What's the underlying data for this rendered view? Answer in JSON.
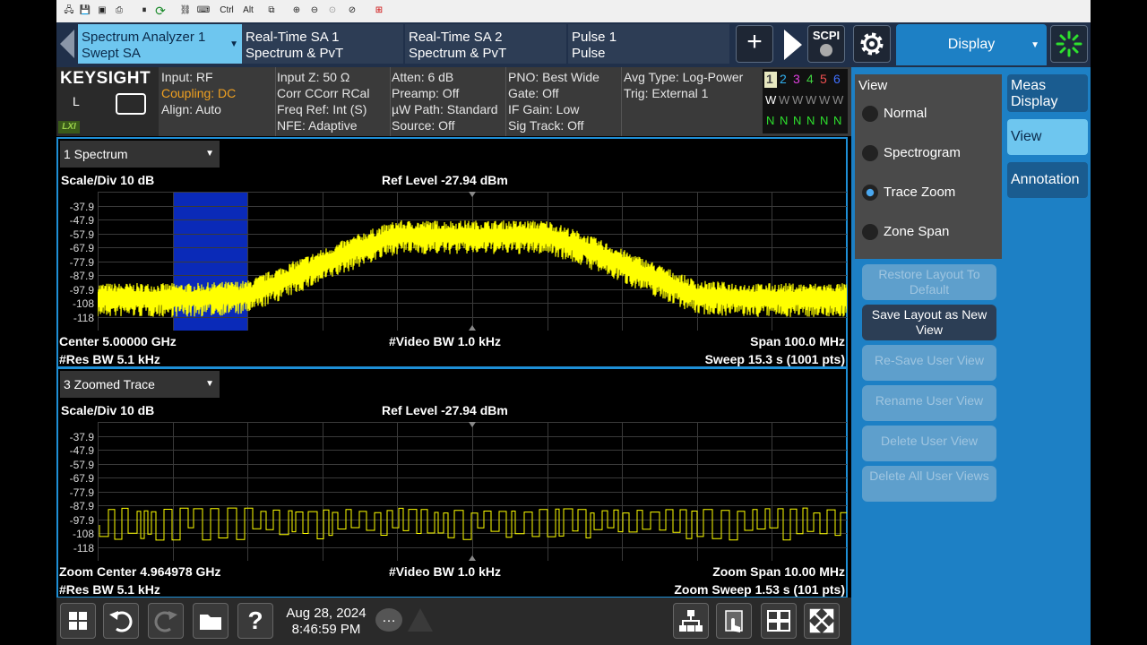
{
  "toolbar": {
    "ctrl_label": "Ctrl",
    "alt_label": "Alt"
  },
  "tabs": [
    {
      "line1": "Spectrum Analyzer 1",
      "line2": "Swept SA"
    },
    {
      "line1": "Real-Time SA 1",
      "line2": "Spectrum & PvT"
    },
    {
      "line1": "Real-Time SA 2",
      "line2": "Spectrum & PvT"
    },
    {
      "line1": "Pulse 1",
      "line2": "Pulse"
    }
  ],
  "header": {
    "scpi_label": "SCPI",
    "menu_title": "Display"
  },
  "brand": {
    "logo": "KEYSIGHT",
    "mode": "L",
    "lxi": "LXI"
  },
  "info": {
    "col1": [
      "Input: RF",
      "Coupling: DC",
      "Align: Auto"
    ],
    "col2": [
      "Input Z: 50 Ω",
      "Corr CCorr RCal",
      "Freq Ref: Int (S)",
      "NFE: Adaptive"
    ],
    "col3": [
      "Atten: 6 dB",
      "Preamp: Off",
      "µW Path: Standard",
      "Source: Off"
    ],
    "col4": [
      "PNO: Best Wide",
      "Gate: Off",
      "IF Gain: Low",
      "Sig Track: Off"
    ],
    "col5": [
      "Avg Type: Log-Power",
      "Trig: External 1"
    ],
    "trace_nums": [
      "1",
      "2",
      "3",
      "4",
      "5",
      "6"
    ],
    "trace_types": [
      "W",
      "W",
      "W",
      "W",
      "W",
      "W"
    ],
    "trace_dets": [
      "N",
      "N",
      "N",
      "N",
      "N",
      "N"
    ]
  },
  "window1": {
    "selector": "1 Spectrum",
    "scale": "Scale/Div 10 dB",
    "ref_level": "Ref Level -27.94 dBm",
    "y_ticks": [
      "-37.9",
      "-47.9",
      "-57.9",
      "-67.9",
      "-77.9",
      "-87.9",
      "-97.9",
      "-108",
      "-118"
    ],
    "bottom_left1": "Center 5.00000 GHz",
    "bottom_left2": "#Res BW 5.1 kHz",
    "bottom_mid": "#Video BW 1.0 kHz",
    "bottom_right1": "Span 100.0 MHz",
    "bottom_right2": "Sweep 15.3 s (1001 pts)"
  },
  "window2": {
    "selector": "3 Zoomed Trace",
    "scale": "Scale/Div 10 dB",
    "ref_level": "Ref Level -27.94 dBm",
    "y_ticks": [
      "-37.9",
      "-47.9",
      "-57.9",
      "-67.9",
      "-77.9",
      "-87.9",
      "-97.9",
      "-108",
      "-118"
    ],
    "bottom_left1": "Zoom Center 4.964978 GHz",
    "bottom_left2": "#Res BW 5.1 kHz",
    "bottom_mid": "#Video BW 1.0 kHz",
    "bottom_right1": "Zoom Span 10.00 MHz",
    "bottom_right2": "Zoom Sweep 1.53 s (101 pts)"
  },
  "view_panel": {
    "title": "View",
    "options": [
      "Normal",
      "Spectrogram",
      "Trace Zoom",
      "Zone Span"
    ],
    "selected": "Trace Zoom",
    "buttons": [
      {
        "label": "Restore Layout To Default",
        "enabled": false
      },
      {
        "label": "Save Layout as New View",
        "enabled": true
      },
      {
        "label": "Re-Save User View",
        "enabled": false
      },
      {
        "label": "Rename User View",
        "enabled": false
      },
      {
        "label": "Delete User View",
        "enabled": false
      },
      {
        "label": "Delete All User Views",
        "enabled": false
      }
    ]
  },
  "side_tabs": [
    "Meas Display",
    "View",
    "Annotation"
  ],
  "status": {
    "date": "Aug 28, 2024",
    "time": "8:46:59 PM"
  },
  "colors": {
    "trace": "#ffff00",
    "accent": "#1d80c5",
    "active_tab": "#6ec6ef",
    "zoom_band": "#0a2ab8"
  }
}
